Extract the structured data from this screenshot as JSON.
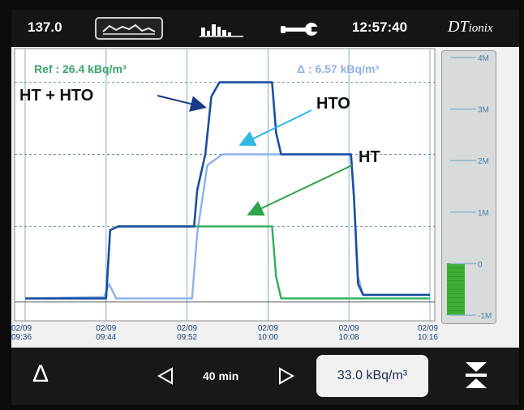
{
  "topbar": {
    "current_value": "137.0",
    "time": "12:57:40",
    "brand_main": "DT",
    "brand_sub": "ionix",
    "icons": {
      "trend": "trend-graph-icon",
      "histogram": "histogram-icon",
      "tools": "wrench-icon"
    }
  },
  "chart_data": {
    "type": "line",
    "ref_label": "Ref : 26.4 kBq/m³",
    "delta_label": "Δ : 6.57 kBq/m³",
    "x_ticks": [
      {
        "date": "02/09",
        "time": "09:36"
      },
      {
        "date": "02/09",
        "time": "09:44"
      },
      {
        "date": "02/09",
        "time": "09:52"
      },
      {
        "date": "02/09",
        "time": "10:00"
      },
      {
        "date": "02/09",
        "time": "10:08"
      },
      {
        "date": "02/09",
        "time": "10:16"
      }
    ],
    "x_minutes_range": [
      0,
      40
    ],
    "y_range_mbq": [
      -0.3,
      3.4
    ],
    "grid": true,
    "series": [
      {
        "name": "HT + HTO",
        "color": "#1a4fa0",
        "points": [
          [
            0,
            0.0
          ],
          [
            8,
            0.0
          ],
          [
            8.4,
            0.95
          ],
          [
            9.2,
            1.0
          ],
          [
            16.7,
            1.0
          ],
          [
            17.0,
            1.5
          ],
          [
            17.8,
            2.0
          ],
          [
            18.4,
            2.8
          ],
          [
            19.2,
            3.0
          ],
          [
            24.4,
            3.0
          ],
          [
            24.8,
            2.3
          ],
          [
            25.3,
            2.0
          ],
          [
            32.2,
            2.0
          ],
          [
            32.5,
            1.4
          ],
          [
            32.9,
            0.2
          ],
          [
            33.4,
            0.05
          ],
          [
            40,
            0.05
          ]
        ]
      },
      {
        "name": "HTO",
        "color": "#8fb0ea",
        "points": [
          [
            0,
            0.0
          ],
          [
            7.8,
            0.02
          ],
          [
            8.3,
            0.2
          ],
          [
            9.0,
            0.0
          ],
          [
            16.5,
            0.0
          ],
          [
            17.0,
            0.9
          ],
          [
            18.0,
            1.85
          ],
          [
            19.5,
            2.0
          ],
          [
            32.2,
            2.0
          ],
          [
            32.5,
            1.4
          ],
          [
            32.9,
            0.3
          ],
          [
            33.4,
            0.05
          ],
          [
            40,
            0.05
          ]
        ]
      },
      {
        "name": "HT",
        "color": "#2fae5e",
        "points": [
          [
            0,
            0.0
          ],
          [
            8,
            0.0
          ],
          [
            8.4,
            0.95
          ],
          [
            9.2,
            1.0
          ],
          [
            24.4,
            1.0
          ],
          [
            24.8,
            0.3
          ],
          [
            25.3,
            0.0
          ],
          [
            40,
            0.0
          ]
        ]
      }
    ],
    "annotations": [
      {
        "text": "HT + HTO",
        "color": "#111111"
      },
      {
        "text": "HTO",
        "color": "#111111"
      },
      {
        "text": "HT",
        "color": "#111111"
      }
    ]
  },
  "gauge": {
    "ticks": [
      "4M",
      "3M",
      "2M",
      "1M",
      "0",
      "-1M"
    ],
    "range": [
      -1,
      4
    ],
    "fill_from": -1,
    "fill_to": 0,
    "fill_color": "#3fae35"
  },
  "bottombar": {
    "delta_symbol": "Δ",
    "window": "40 min",
    "reading": "33.0 kBq/m³",
    "icons": {
      "prev": "triangle-left-icon",
      "next": "triangle-right-icon",
      "scale": "scale-toggle-icon"
    }
  }
}
